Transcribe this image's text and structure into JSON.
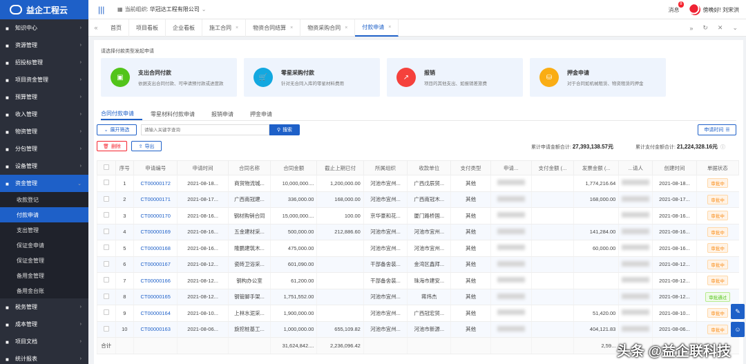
{
  "brand": {
    "name": "益企工程云",
    "color": "#1e60c8"
  },
  "sidebar": {
    "items": [
      {
        "label": "知识中心"
      },
      {
        "label": "资源管理"
      },
      {
        "label": "招投标管理"
      },
      {
        "label": "项目资金管理"
      },
      {
        "label": "预算管理"
      },
      {
        "label": "收入管理"
      },
      {
        "label": "物资管理"
      },
      {
        "label": "分包管理"
      },
      {
        "label": "设备管理"
      },
      {
        "label": "资金管理"
      }
    ],
    "submenu": [
      {
        "label": "收款登记"
      },
      {
        "label": "付款申请"
      },
      {
        "label": "支出管理"
      },
      {
        "label": "保证金申请"
      },
      {
        "label": "保证金管理"
      },
      {
        "label": "备用金管理"
      },
      {
        "label": "备用金台账"
      }
    ],
    "items_after": [
      {
        "label": "税务管理"
      },
      {
        "label": "成本管理"
      },
      {
        "label": "项目文档"
      },
      {
        "label": "统计报表"
      }
    ]
  },
  "header": {
    "org_label": "当前组织:",
    "org_name": "华冠达工程有限公司",
    "messages_label": "消息",
    "messages_count": "8",
    "greeting": "傍晚好! 刘宋洪"
  },
  "tabs": [
    {
      "label": "首页",
      "closable": false
    },
    {
      "label": "项目看板",
      "closable": false
    },
    {
      "label": "企业看板",
      "closable": false
    },
    {
      "label": "施工合同",
      "closable": true
    },
    {
      "label": "物资合同结算",
      "closable": true
    },
    {
      "label": "物资采购合同",
      "closable": true
    },
    {
      "label": "付款申请",
      "closable": true,
      "active": true
    }
  ],
  "page": {
    "section_title": "请选择付款类型发起申请",
    "cards": [
      {
        "title": "支出合同付款",
        "desc": "依据支出合同付款、可申请预付款或进度款",
        "color": "#52c41a",
        "icon": "▣"
      },
      {
        "title": "零星采购付款",
        "desc": "针对无合同入库的零星材料费用",
        "color": "#13a8e0",
        "icon": "🛒"
      },
      {
        "title": "报销",
        "desc": "项目的其他支出、如报销差旅费",
        "color": "#f5413c",
        "icon": "↗"
      },
      {
        "title": "押金申请",
        "desc": "对于合同如机械租赁、物资租赁的押金",
        "color": "#faad14",
        "icon": "⛁"
      }
    ],
    "sub_tabs": [
      "合同付款申请",
      "零星材料付款申请",
      "报销申请",
      "押金申请"
    ],
    "expand_label": "展开筛选",
    "search_placeholder": "请输入关键字查询",
    "search_label": "搜索",
    "date_label": "申请时间",
    "delete_label": "删除",
    "export_label": "导出",
    "total_apply_label": "累计申请金额合计:",
    "total_apply_value": "27,393,138.57元",
    "total_paid_label": "累计支付金额合计:",
    "total_paid_value": "21,224,328.16元"
  },
  "table": {
    "columns": [
      "序号",
      "申请编号",
      "申请时间",
      "合同名称",
      "合同金额",
      "截止上期已付",
      "所属组织",
      "收款单位",
      "支付类型",
      "申请...",
      "支付金额 (...",
      "发票金额 (...",
      "...请人",
      "创建时间",
      "单据状态"
    ],
    "rows": [
      {
        "no": "1",
        "code": "CT00000172",
        "time": "2021-08-18...",
        "contract": "商贸物流城...",
        "amount": "10,000,000....",
        "paid_prev": "1,200,000.00",
        "org": "河池市宜州...",
        "payee": "广西戊辰贸...",
        "pay_type": "其他",
        "invoice": "1,774,216.64",
        "created": "2021-08-18...",
        "status": "审批中"
      },
      {
        "no": "2",
        "code": "CT00000171",
        "time": "2021-08-17...",
        "contract": "广西南冠建...",
        "amount": "336,000.00",
        "paid_prev": "168,000.00",
        "org": "河池市宜州...",
        "payee": "广西南冠木...",
        "pay_type": "其他",
        "invoice": "168,000.00",
        "created": "2021-08-17...",
        "status": "审批中"
      },
      {
        "no": "3",
        "code": "CT00000170",
        "time": "2021-08-16...",
        "contract": "钢材购销合同",
        "amount": "15,000,000....",
        "paid_prev": "100.00",
        "org": "京华豪和花...",
        "payee": "厦门路桥国...",
        "pay_type": "其他",
        "invoice": "",
        "created": "2021-08-16...",
        "status": "审批中"
      },
      {
        "no": "4",
        "code": "CT00000169",
        "time": "2021-08-16...",
        "contract": "五金建材采...",
        "amount": "500,000.00",
        "paid_prev": "212,886.60",
        "org": "河池市宜州...",
        "payee": "河池市宜州...",
        "pay_type": "其他",
        "invoice": "141,284.00",
        "created": "2021-08-16...",
        "status": "审批中"
      },
      {
        "no": "5",
        "code": "CT00000168",
        "time": "2021-08-16...",
        "contract": "隆鹏建筑木...",
        "amount": "475,000.00",
        "paid_prev": "",
        "org": "河池市宜州...",
        "payee": "河池市宜州...",
        "pay_type": "其他",
        "invoice": "60,000.00",
        "created": "2021-08-16...",
        "status": "审批中"
      },
      {
        "no": "6",
        "code": "CT00000167",
        "time": "2021-08-12...",
        "contract": "瓷砖卫浴采...",
        "amount": "601,090.00",
        "paid_prev": "",
        "org": "干部备舍装...",
        "payee": "金湾区鑫拜...",
        "pay_type": "其他",
        "invoice": "",
        "created": "2021-08-12...",
        "status": "审批中"
      },
      {
        "no": "7",
        "code": "CT00000166",
        "time": "2021-08-12...",
        "contract": "钢构办公室",
        "amount": "61,200.00",
        "paid_prev": "",
        "org": "干部备舍装...",
        "payee": "珠海市建安...",
        "pay_type": "其他",
        "invoice": "",
        "created": "2021-08-12...",
        "status": "审批中"
      },
      {
        "no": "8",
        "code": "CT00000165",
        "time": "2021-08-12...",
        "contract": "钢管脚手架...",
        "amount": "1,751,552.00",
        "paid_prev": "",
        "org": "河池市宜州...",
        "payee": "蒋炜杰",
        "pay_type": "其他",
        "invoice": "",
        "created": "2021-08-12...",
        "status": "审批通过"
      },
      {
        "no": "9",
        "code": "CT00000164",
        "time": "2021-08-10...",
        "contract": "上林水泥采...",
        "amount": "1,900,000.00",
        "paid_prev": "",
        "org": "河池市宜州...",
        "payee": "广西冠宏贸...",
        "pay_type": "其他",
        "invoice": "51,420.00",
        "created": "2021-08-10...",
        "status": "审批中"
      },
      {
        "no": "10",
        "code": "CT00000163",
        "time": "2021-08-06...",
        "contract": "旋挖桩基工...",
        "amount": "1,000,000.00",
        "paid_prev": "655,109.82",
        "org": "河池市宜州...",
        "payee": "河池市新源...",
        "pay_type": "其他",
        "invoice": "404,121.83",
        "created": "2021-08-06...",
        "status": "审批中"
      }
    ],
    "summary": {
      "label": "合计",
      "amount": "31,624,842....",
      "paid_prev": "2,236,096.42",
      "invoice": "2,59..."
    }
  },
  "watermark": "头条 @益企联科技"
}
